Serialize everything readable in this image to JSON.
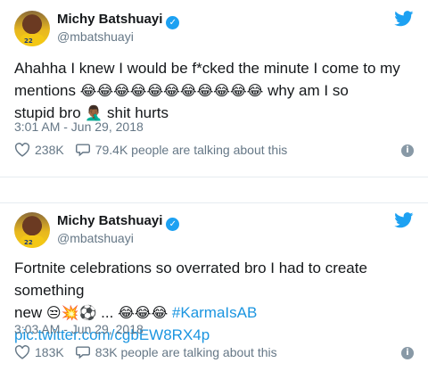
{
  "tweets": [
    {
      "author_name": "Michy Batshuayi",
      "handle": "@mbatshuayi",
      "text_line1": "Ahahha I knew I would be f*cked the minute I come to my",
      "text_line2_prefix": "mentions ",
      "text_line2_emoji": "😂😂😂😂😂😂😂😂😂😂😂",
      "text_line2_suffix": " why am I so",
      "text_line3_prefix": "stupid bro ",
      "text_line3_emoji": "🤦🏾‍♂️",
      "text_line3_suffix": " shit hurts",
      "timestamp": "3:01 AM - Jun 29, 2018",
      "likes": "238K",
      "talking": "79.4K people are talking about this",
      "avatar_number": "22"
    },
    {
      "author_name": "Michy Batshuayi",
      "handle": "@mbatshuayi",
      "text_line1": "Fortnite celebrations so overrated bro I had to create something",
      "text_line2_prefix": "new ",
      "text_line2_emoji": "😒💥⚽",
      "text_line2_mid": " ... ",
      "text_line2_emoji2": "😂😂😂",
      "text_line2_hashtag": " #KarmaIsAB",
      "link": "pic.twitter.com/cgbEW8RX4p",
      "timestamp": "3:03 AM - Jun 29, 2018",
      "likes": "183K",
      "talking": "83K people are talking about this",
      "avatar_number": "22"
    }
  ],
  "icons": {
    "verified": "verified-badge-icon",
    "bird": "twitter-bird-icon",
    "heart": "heart-icon",
    "reply": "reply-bubble-icon",
    "info": "info-icon"
  },
  "colors": {
    "twitter_blue": "#1da1f2",
    "link": "#1b95e0",
    "secondary_text": "#657786"
  }
}
